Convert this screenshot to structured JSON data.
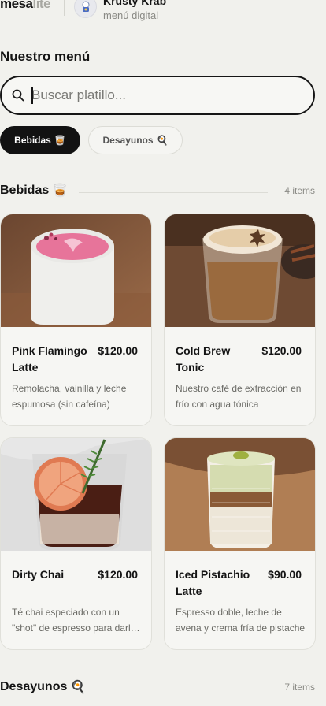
{
  "header": {
    "brand_main": "mesa",
    "brand_sub": "lite",
    "store_name": "Krusty Krab",
    "store_subtitle": "menú digital"
  },
  "page_title": "Nuestro menú",
  "search": {
    "placeholder": "Buscar platillo...",
    "value": ""
  },
  "chips": [
    {
      "label": "Bebidas",
      "emoji": "🥃",
      "active": true
    },
    {
      "label": "Desayunos",
      "emoji": "🍳",
      "active": false
    }
  ],
  "sections": [
    {
      "title": "Bebidas",
      "emoji": "🥃",
      "count": "4 items",
      "items": [
        {
          "name": "Pink Flamingo Latte",
          "price": "$120.00",
          "desc": "Remolacha, vainilla y leche espumosa (sin cafeína)"
        },
        {
          "name": "Cold Brew Tonic",
          "price": "$120.00",
          "desc": "Nuestro café de extracción en frío con agua tónica"
        },
        {
          "name": "Dirty Chai",
          "price": "$120.00",
          "desc": "Té chai especiado con un \"shot\" de espresso para darle energía"
        },
        {
          "name": "Iced Pistachio Latte",
          "price": "$90.00",
          "desc": "Espresso doble, leche de avena y crema fría de pistache"
        }
      ]
    },
    {
      "title": "Desayunos",
      "emoji": "🍳",
      "count": "7 items"
    }
  ],
  "colors": {
    "background": "#f1f1ed",
    "active_chip": "#121212",
    "text": "#141414",
    "muted": "#8a8a85"
  }
}
